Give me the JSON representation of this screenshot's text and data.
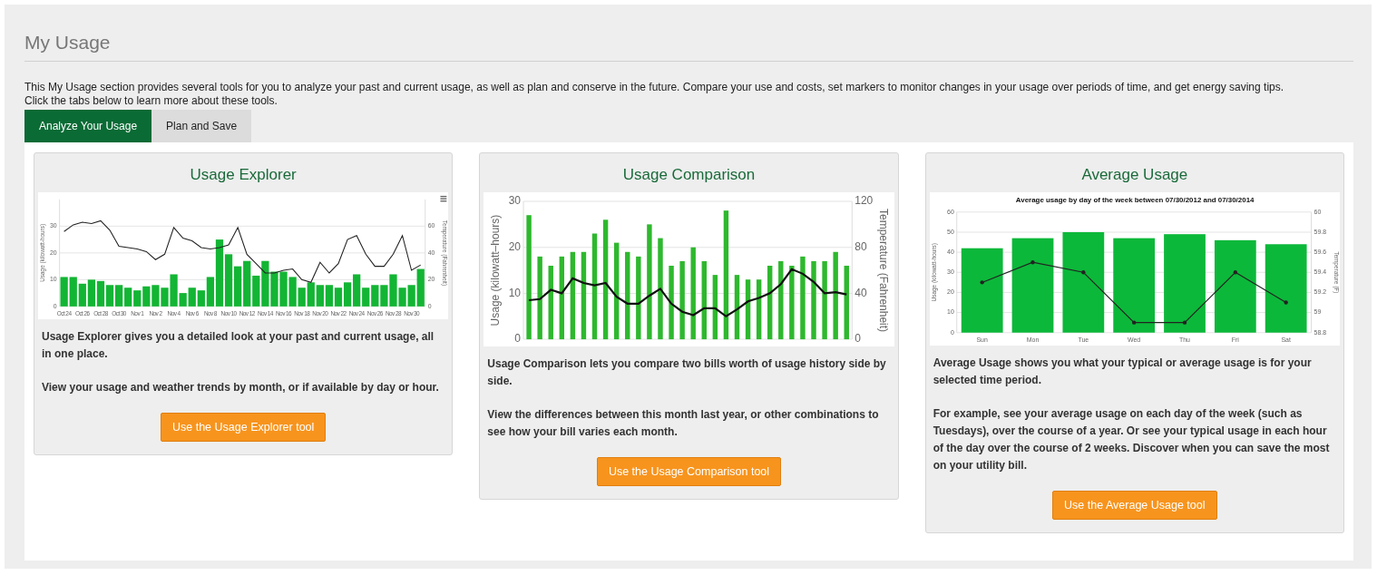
{
  "page": {
    "title": "My Usage",
    "intro": [
      "This My Usage section provides several tools for you to analyze your past and current usage, as well as plan and conserve in the future. Compare your use and costs, set markers to monitor changes in your usage over periods of time, and get energy saving tips.",
      "Click the tabs below to learn more about these tools."
    ]
  },
  "tabs": [
    {
      "label": "Analyze Your Usage",
      "selected": true
    },
    {
      "label": "Plan and Save",
      "selected": false
    }
  ],
  "cards": [
    {
      "title": "Usage Explorer",
      "has_menu": true,
      "chart_data": {
        "type": "bar",
        "ylabel": "Usage (kilowatt-hours)",
        "y2label": "Temperature (Fahrenheit)",
        "grid": true,
        "ylim": [
          0,
          40
        ],
        "y2lim": [
          0,
          80
        ],
        "yticks": [
          0,
          10,
          20,
          30
        ],
        "y2ticks": [
          0,
          20,
          40,
          60
        ],
        "categories": [
          "Oct 24",
          null,
          "Oct 26",
          null,
          "Oct 28",
          null,
          "Oct 30",
          null,
          "Nov 1",
          null,
          "Nov 2",
          null,
          "Nov 4",
          null,
          "Nov 6",
          null,
          "Nov 8",
          null,
          "Nov 10",
          null,
          "Nov 12",
          null,
          "Nov 14",
          null,
          "Nov 16",
          null,
          "Nov 18",
          null,
          "Nov 20",
          null,
          "Nov 22",
          null,
          "Nov 24",
          null,
          "Nov 26",
          null,
          "Nov 28",
          null,
          "Nov 30",
          null
        ],
        "series": [
          {
            "type": "bar",
            "color": "#13b534",
            "values": [
              11,
              11,
              8.5,
              10,
              9.5,
              8,
              8,
              7,
              6,
              7.5,
              8,
              7,
              12,
              5,
              7,
              6,
              11,
              25,
              19.5,
              15,
              17,
              11.5,
              17,
              13,
              13,
              11,
              7,
              9,
              8,
              8,
              7,
              9,
              12,
              7,
              8,
              8,
              12,
              7,
              8,
              14
            ]
          },
          {
            "type": "line",
            "axis": "y2",
            "color": "#222222",
            "values": [
              56,
              61,
              63,
              62,
              64,
              57,
              45,
              44,
              43,
              41,
              35,
              39,
              59,
              51,
              49,
              44,
              43,
              44,
              46,
              59,
              39,
              32,
              25,
              25,
              27,
              28,
              20,
              18,
              33,
              25,
              32,
              50,
              53,
              39,
              30,
              30,
              39,
              53,
              27,
              31
            ]
          }
        ]
      },
      "paragraphs": [
        "Usage Explorer gives you a detailed look at your past and current usage, all in one place.",
        "View your usage and weather trends by month, or if available by day or hour."
      ],
      "button": "Use the Usage Explorer tool"
    },
    {
      "title": "Usage Comparison",
      "chart_data": {
        "type": "bar",
        "ylabel": "Usage (kilowatt–hours)",
        "y2label": "Temperature (Fahrenheit)",
        "grid": true,
        "ylim": [
          0,
          30
        ],
        "y2lim": [
          0,
          120
        ],
        "yticks": [
          0,
          10,
          20,
          30
        ],
        "y2ticks": [
          0,
          40,
          80,
          120
        ],
        "series": [
          {
            "type": "bar",
            "color": "#2eb82e",
            "values": [
              27,
              18,
              16,
              18,
              19,
              19,
              23,
              26,
              21,
              19,
              18,
              25,
              22,
              16,
              17,
              20,
              17,
              14,
              28,
              14,
              13,
              13,
              16,
              17,
              16,
              18,
              17,
              17,
              19,
              16
            ]
          },
          {
            "type": "line",
            "axis": "y2",
            "color": "#111111",
            "values": [
              34,
              35,
              43,
              40,
              53,
              49,
              47,
              49,
              37,
              31,
              31,
              38,
              44,
              31,
              24,
              21,
              27,
              27,
              20,
              26,
              33,
              36,
              40,
              48,
              61,
              57,
              50,
              40,
              41,
              39
            ]
          }
        ]
      },
      "paragraphs": [
        "Usage Comparison lets you compare two bills worth of usage history side by side.",
        "View the differences between this month last year, or other combinations to see how your bill varies each month."
      ],
      "button": "Use the Usage Comparison tool"
    },
    {
      "title": "Average Usage",
      "chart_data": {
        "type": "bar",
        "title": "Average usage by day of the week between 07/30/2012 and 07/30/2014",
        "ylabel": "Usage (kilowatt-hours)",
        "y2label": "Temperature (F)",
        "grid": true,
        "ylim": [
          0,
          60
        ],
        "y2lim": [
          58.8,
          60
        ],
        "yticks": [
          0,
          10,
          20,
          30,
          40,
          50,
          60
        ],
        "y2ticks": [
          58.8,
          59,
          59.2,
          59.4,
          59.6,
          59.8,
          60
        ],
        "categories": [
          "Sun",
          "Mon",
          "Tue",
          "Wed",
          "Thu",
          "Fri",
          "Sat"
        ],
        "series": [
          {
            "type": "bar",
            "color": "#0cb83a",
            "values": [
              42,
              47,
              50,
              47,
              49,
              46,
              44
            ]
          },
          {
            "type": "line",
            "axis": "y2",
            "color": "#222222",
            "values": [
              59.3,
              59.5,
              59.4,
              58.9,
              58.9,
              59.4,
              59.1
            ]
          }
        ]
      },
      "paragraphs": [
        "Average Usage shows you what your typical or average usage is for your selected time period.",
        "For example, see your average usage on each day of the week (such as Tuesdays), over the course of a year. Or see your typical usage in each hour of the day over the course of 2 weeks. Discover when you can save the most on your utility bill."
      ],
      "button": "Use the Average Usage tool"
    }
  ]
}
